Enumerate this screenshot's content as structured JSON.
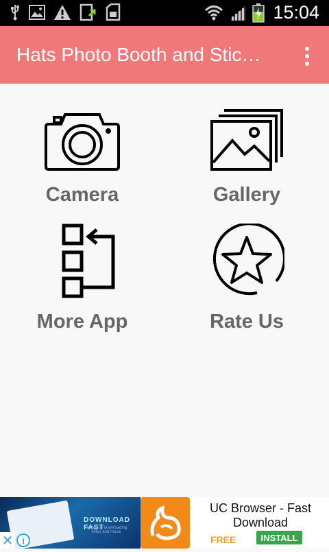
{
  "status_bar": {
    "time": "15:04",
    "icons": [
      "usb-icon",
      "image-icon",
      "warning-icon",
      "update-icon",
      "sdcard-icon",
      "wifi-icon",
      "signal-icon",
      "battery-charging-icon"
    ]
  },
  "app_bar": {
    "title": "Hats Photo Booth and Stic…",
    "overflow_icon": "more-vert-icon",
    "background": "#f07878"
  },
  "menu": {
    "items": [
      {
        "label": "Camera",
        "icon": "camera-icon"
      },
      {
        "label": "Gallery",
        "icon": "gallery-icon"
      },
      {
        "label": "More App",
        "icon": "more-apps-icon"
      },
      {
        "label": "Rate Us",
        "icon": "star-icon"
      }
    ]
  },
  "ad": {
    "image_caption": "DOWNLOAD FAST",
    "image_subcaption": "Speed up downloading video and music",
    "title": "UC Browser - Fast Download",
    "price": "FREE",
    "install_label": "INSTALL",
    "close_icon": "close-icon",
    "info_icon": "info-icon",
    "info_glyph": "i",
    "close_glyph": "✕"
  }
}
